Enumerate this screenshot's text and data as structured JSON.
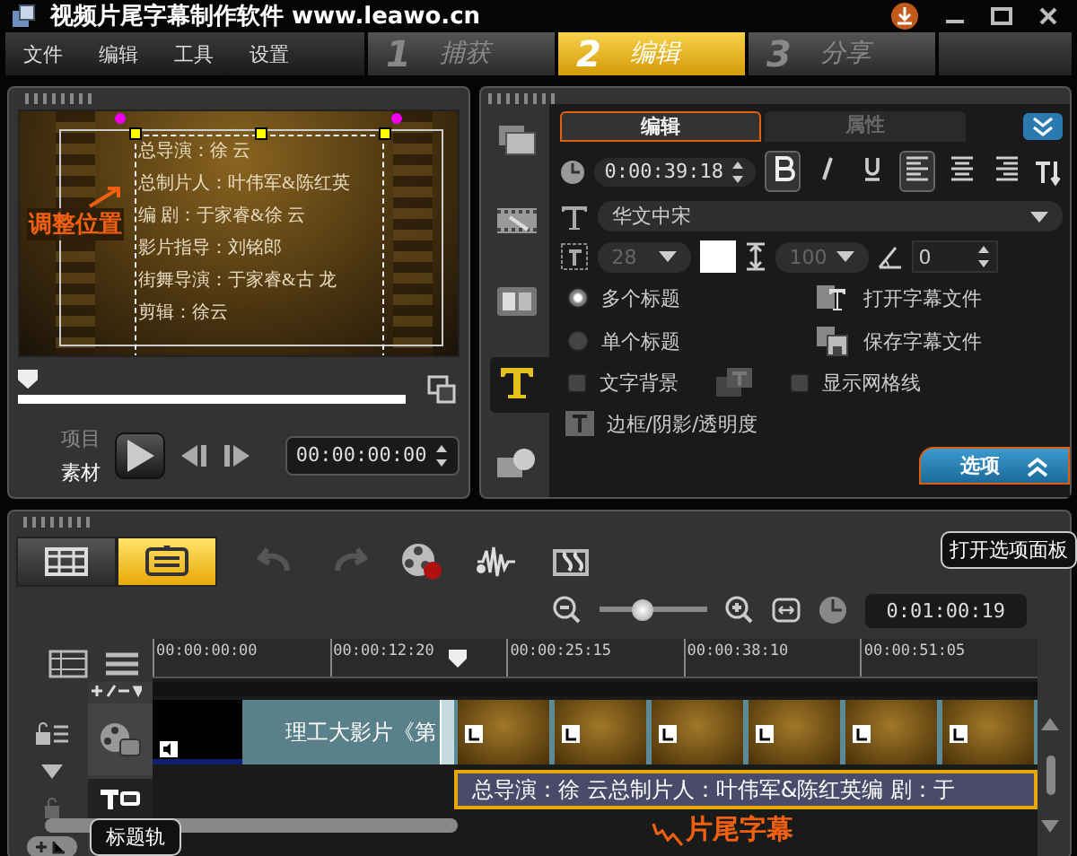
{
  "window": {
    "title": "视频片尾字幕制作软件 www.leawo.cn"
  },
  "menu": [
    "文件",
    "编辑",
    "工具",
    "设置"
  ],
  "steps": [
    {
      "number": "1",
      "label": "捕获",
      "selected": false
    },
    {
      "number": "2",
      "label": "编辑",
      "selected": true
    },
    {
      "number": "3",
      "label": "分享",
      "selected": false
    }
  ],
  "preview": {
    "title_lines": [
      "总导演：徐  云",
      "总制片人：叶伟军&陈红英",
      "编  剧：于家睿&徐  云",
      "影片指导：刘铭郎",
      "街舞导演：于家睿&古  龙",
      "剪辑：徐云"
    ],
    "annotation": "调整位置",
    "scrub": {
      "level": 0
    },
    "modes": [
      {
        "label": "项目",
        "selected": false
      },
      {
        "label": "素材",
        "selected": true
      }
    ],
    "timecode": "00:00:00:00"
  },
  "options": {
    "side_tabs": [
      {
        "kind": "media",
        "selected": false
      },
      {
        "kind": "filmstrip",
        "selected": false
      },
      {
        "kind": "transition",
        "selected": false
      },
      {
        "kind": "title",
        "selected": true
      },
      {
        "kind": "graphic",
        "selected": false
      }
    ],
    "tabs": [
      {
        "label": "编辑",
        "selected": true
      },
      {
        "label": "属性",
        "selected": false
      }
    ],
    "duration": "0:00:39:18",
    "styles": [
      {
        "kind": "bold",
        "on": true
      },
      {
        "kind": "italic",
        "on": false
      },
      {
        "kind": "underline",
        "on": false
      }
    ],
    "aligns": [
      {
        "kind": "left",
        "selected": true
      },
      {
        "kind": "center",
        "selected": false
      },
      {
        "kind": "right",
        "selected": false
      }
    ],
    "font": "华文中宋",
    "size": "28",
    "line_spacing": "100",
    "angle": "0",
    "title_modes": [
      {
        "label": "多个标题",
        "selected": true
      },
      {
        "label": "单个标题",
        "selected": false
      }
    ],
    "checkboxes": [
      {
        "label": "文字背景",
        "checked": false
      },
      {
        "label": "显示网格线",
        "checked": false
      }
    ],
    "file_buttons": [
      "打开字幕文件",
      "保存字幕文件"
    ],
    "border_button": "边框/阴影/透明度",
    "options_button": "选项",
    "tooltip": "打开选项面板"
  },
  "timeline": {
    "views": [
      {
        "kind": "storyboard",
        "selected": false
      },
      {
        "kind": "timeline",
        "selected": true
      }
    ],
    "timecode": "0:01:00:19",
    "zoom": {
      "level": 0.4
    },
    "ruler": [
      "00:00:00:00",
      "00:00:12:20",
      "00:00:25:15",
      "00:00:38:10",
      "00:00:51:05"
    ],
    "video_clip": "理工大影片《第",
    "title_clip": "总导演：徐  云总制片人：叶伟军&陈红英编  剧：于",
    "annotation": "片尾字幕",
    "tooltip": "标题轨"
  }
}
